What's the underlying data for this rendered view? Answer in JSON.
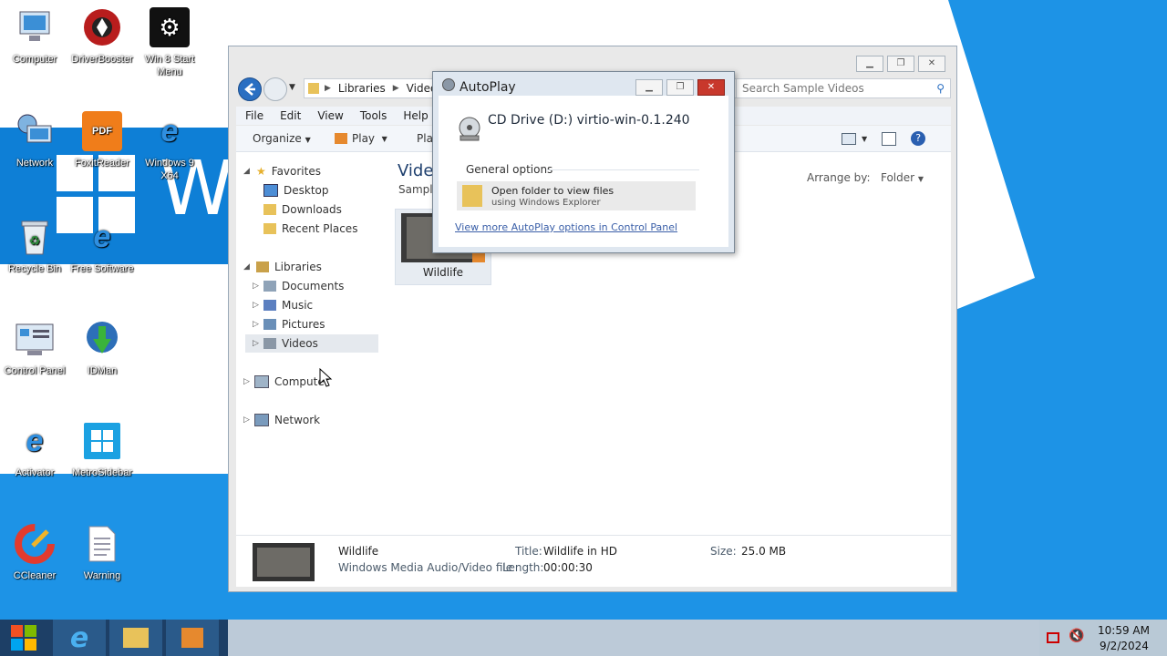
{
  "desktop": {
    "icons": [
      {
        "label": "Computer",
        "icon": "computer-icon"
      },
      {
        "label": "DriverBooster",
        "icon": "driverbooster-icon"
      },
      {
        "label": "Win 8 Start Menu",
        "icon": "gear-icon"
      },
      {
        "label": "Network",
        "icon": "network-icon"
      },
      {
        "label": "FoxitReader",
        "icon": "pdf-icon"
      },
      {
        "label": "Windows 9 X64",
        "icon": "ie-icon"
      },
      {
        "label": "Recycle Bin",
        "icon": "recycle-bin-icon"
      },
      {
        "label": "Free Software",
        "icon": "ie-icon"
      },
      {
        "label": "Control Panel",
        "icon": "control-panel-icon"
      },
      {
        "label": "IDMan",
        "icon": "idm-icon"
      },
      {
        "label": "Activator",
        "icon": "ie-icon"
      },
      {
        "label": "MetroSidebar",
        "icon": "windows-icon"
      },
      {
        "label": "CCleaner",
        "icon": "ccleaner-icon"
      },
      {
        "label": "Warning",
        "icon": "document-icon"
      }
    ],
    "wallpaper_text": "Wi"
  },
  "explorer": {
    "breadcrumb": [
      "Libraries",
      "Videos"
    ],
    "search_placeholder": "Search Sample Videos",
    "menu": [
      "File",
      "Edit",
      "View",
      "Tools",
      "Help"
    ],
    "cmd": {
      "organize": "Organize",
      "play": "Play",
      "play_all": "Pla"
    },
    "nav": {
      "favorites": "Favorites",
      "desktop": "Desktop",
      "downloads": "Downloads",
      "recent": "Recent Places",
      "libraries": "Libraries",
      "documents": "Documents",
      "music": "Music",
      "pictures": "Pictures",
      "videos": "Videos",
      "computer": "Computer",
      "network": "Network"
    },
    "content": {
      "title": "Vide",
      "subtitle": "Sample",
      "arrange_label": "Arrange by:",
      "arrange_value": "Folder",
      "file_name": "Wildlife"
    },
    "details": {
      "name": "Wildlife",
      "type": "Windows Media Audio/Video file",
      "title_label": "Title:",
      "title_value": "Wildlife in HD",
      "length_label": "Length:",
      "length_value": "00:00:30",
      "size_label": "Size:",
      "size_value": "25.0 MB"
    }
  },
  "autoplay": {
    "title": "AutoPlay",
    "drive": "CD Drive (D:) virtio-win-0.1.240",
    "section": "General options",
    "option_title": "Open folder to view files",
    "option_sub": "using Windows Explorer",
    "link": "View more AutoPlay options in Control Panel"
  },
  "taskbar": {
    "time": "10:59 AM",
    "date": "9/2/2024"
  },
  "colors": {
    "accent": "#1d93e6",
    "link": "#3a5fa8",
    "taskbar": "#1d3f66"
  }
}
